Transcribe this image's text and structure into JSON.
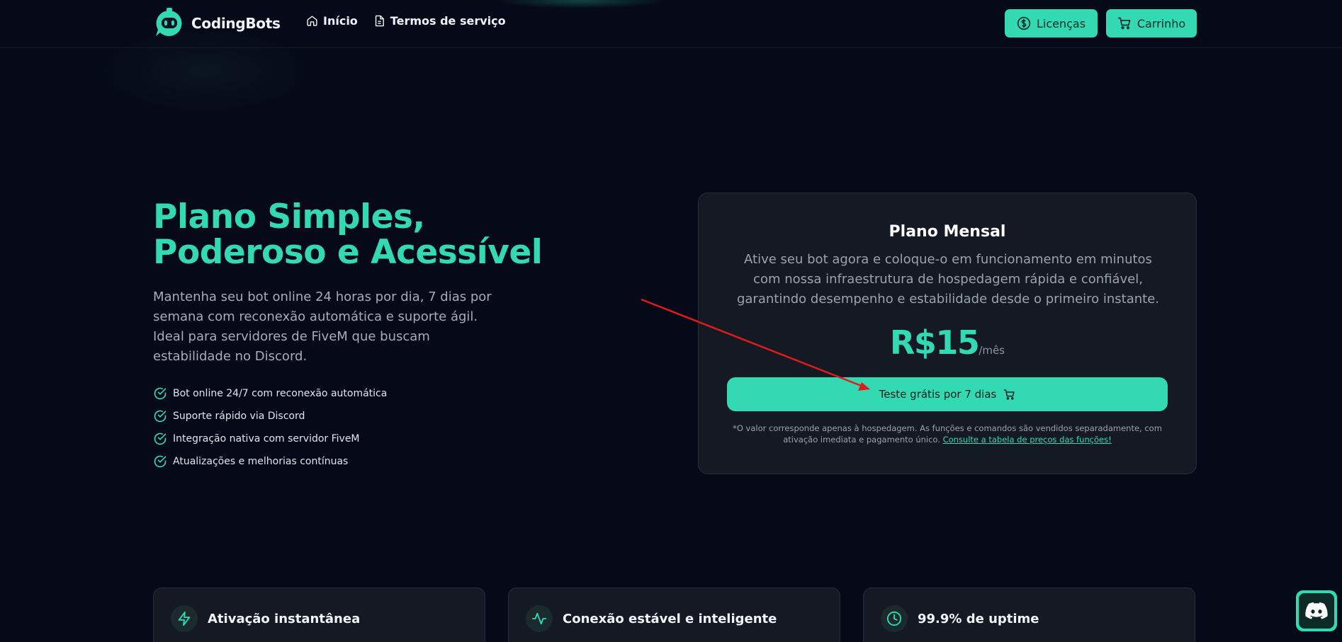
{
  "brand": {
    "name": "CodingBots"
  },
  "nav": {
    "home": "Início",
    "terms": "Termos de serviço"
  },
  "header_buttons": {
    "licenses": "Licenças",
    "cart": "Carrinho"
  },
  "hero": {
    "title": "Plano Simples, Poderoso e Acessível",
    "description": "Mantenha seu bot online 24 horas por dia, 7 dias por semana com reconexão automática e suporte ágil. Ideal para servidores de FiveM que buscam estabilidade no Discord.",
    "features": [
      "Bot online 24/7 com reconexão automática",
      "Suporte rápido via Discord",
      "Integração nativa com servidor FiveM",
      "Atualizações e melhorias contínuas"
    ]
  },
  "plan": {
    "title": "Plano Mensal",
    "description": "Ative seu bot agora e coloque-o em funcionamento em minutos com nossa infraestrutura de hospedagem rápida e confiável, garantindo desempenho e estabilidade desde o primeiro instante.",
    "price": "R$15",
    "period": "/mês",
    "cta": "Teste grátis por 7 dias",
    "note": "*O valor corresponde apenas à hospedagem. As funções e comandos são vendidos separadamente, com ativação imediata e pagamento único.",
    "note_link": "Consulte a tabela de preços das funções!"
  },
  "feature_cards": [
    {
      "title": "Ativação instantânea",
      "icon": "lightning-icon"
    },
    {
      "title": "Conexão estável e inteligente",
      "icon": "activity-icon"
    },
    {
      "title": "99.9% de uptime",
      "icon": "clock-icon"
    }
  ],
  "colors": {
    "accent": "#33d9b2",
    "background": "#060a18",
    "card": "#141923",
    "annotation_arrow": "#e01b1b"
  }
}
